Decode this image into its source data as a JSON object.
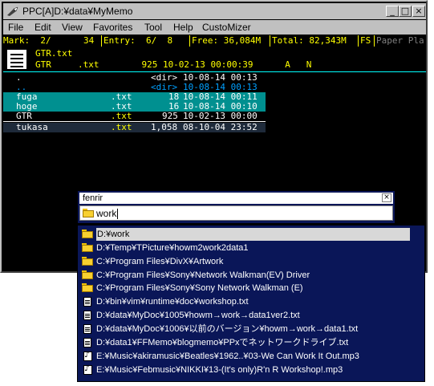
{
  "window": {
    "title": "PPC[A]D:¥data¥MyMemo",
    "buttons": {
      "minimize": "_",
      "maximize": "□",
      "close": "×"
    }
  },
  "menu": [
    "File",
    "Edit",
    "View",
    "Favorites",
    "Tool",
    "Help",
    "CustoMizer"
  ],
  "infobar": {
    "mark": "Mark:  2/",
    "mark_count": "34",
    "entry": "Entry:  6/  8",
    "free": "Free: 36,084M",
    "total": "Total: 82,343M",
    "fs": "FS",
    "paper": "Paper Pla"
  },
  "current_file": {
    "name": "GTR.txt",
    "detail": "GTR     .txt        925 10-02-13 00:00:39      A   N"
  },
  "files": [
    {
      "name": ".",
      "ext": "",
      "size": "<dir>",
      "date": "10-08-14 00:13",
      "selected": false
    },
    {
      "name": "..",
      "ext": "",
      "size": "<dir>",
      "date": "10-08-14 00:13",
      "selected": false
    },
    {
      "name": "fuga",
      "ext": ".txt",
      "size": "18",
      "date": "10-08-14 00:11",
      "selected": true
    },
    {
      "name": "hoge",
      "ext": ".txt",
      "size": "16",
      "date": "10-08-14 00:10",
      "selected": true
    },
    {
      "name": "GTR",
      "ext": ".txt",
      "size": "925",
      "date": "10-02-13 00:00",
      "selected": false
    },
    {
      "name": "tukasa",
      "ext": ".txt",
      "size": "1,058",
      "date": "08-10-04 23:52",
      "selected": false
    }
  ],
  "dialog": {
    "title": "fenrir",
    "close": "×",
    "input_value": "work"
  },
  "completions": [
    {
      "icon": "folder-icon",
      "label": "D:¥work",
      "selected": true
    },
    {
      "icon": "folder-icon",
      "label": "D:¥Temp¥TPicture¥howm2work2data1",
      "selected": false
    },
    {
      "icon": "folder-icon",
      "label": "C:¥Program Files¥DivX¥Artwork",
      "selected": false
    },
    {
      "icon": "folder-icon",
      "label": "C:¥Program Files¥Sony¥Network Walkman(EV) Driver",
      "selected": false
    },
    {
      "icon": "folder-icon",
      "label": "C:¥Program Files¥Sony¥Sony Network Walkman (E)",
      "selected": false
    },
    {
      "icon": "text-file-icon",
      "label": "D:¥bin¥vim¥runtime¥doc¥workshop.txt",
      "selected": false
    },
    {
      "icon": "text-file-icon",
      "label": "D:¥data¥MyDoc¥1005¥howm→work→data1ver2.txt",
      "selected": false
    },
    {
      "icon": "text-file-icon",
      "label": "D:¥data¥MyDoc¥1006¥以前のバージョン¥howm→work→data1.txt",
      "selected": false
    },
    {
      "icon": "text-file-icon",
      "label": "D:¥data1¥FFMemo¥blogmemo¥PPxでネットワークドライブ.txt",
      "selected": false
    },
    {
      "icon": "music-file-icon",
      "label": "E:¥Music¥akiramusic¥Beatles¥1962..¥03-We Can Work It Out.mp3",
      "selected": false
    },
    {
      "icon": "music-file-icon",
      "label": "E:¥Music¥Febmusic¥NIKKI¥13-(It's only)R'n R Workshop!.mp3",
      "selected": false
    }
  ]
}
